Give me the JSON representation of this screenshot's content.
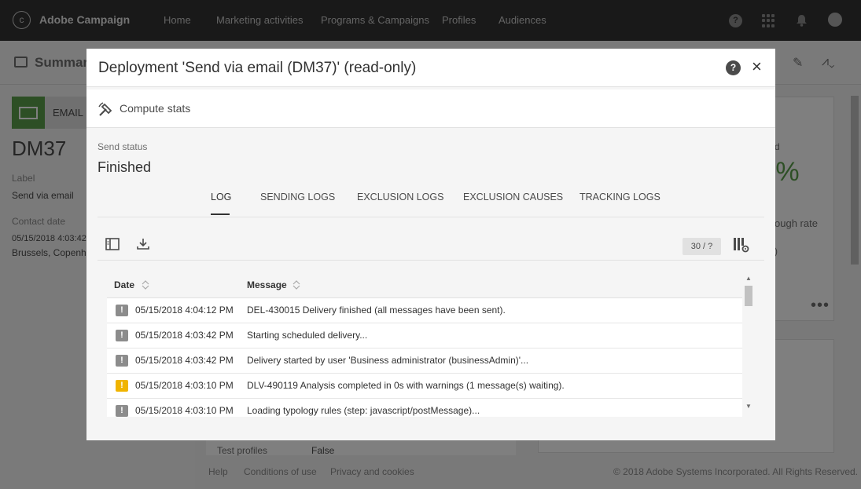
{
  "topbar": {
    "brand": "Adobe Campaign",
    "nav": [
      "Home",
      "Marketing activities",
      "Programs & Campaigns",
      "Profiles",
      "Audiences"
    ],
    "help_glyph": "?"
  },
  "background": {
    "summary_title": "Summary",
    "email_label": "EMAIL",
    "dm_title": "DM37",
    "label_caption": "Label",
    "label_value": "Send via email",
    "contact_caption": "Contact date",
    "contact_value": "05/15/2018 4:03:42",
    "contact_place": "Brussels, Copenha",
    "right_caption": "d",
    "right_pct": ")%",
    "right_rate": "ough rate",
    "right_small": ")",
    "mid_label": "Test profiles",
    "mid_value": "False",
    "footer_links": [
      "Help",
      "Conditions of use",
      "Privacy and cookies"
    ],
    "copyright": "© 2018 Adobe Systems Incorporated. All Rights Reserved."
  },
  "modal": {
    "title": "Deployment 'Send via email (DM37)' (read-only)",
    "help_glyph": "?",
    "close_glyph": "×",
    "compute_label": "Compute stats",
    "send_status_label": "Send status",
    "send_status_value": "Finished",
    "tabs": [
      "LOG",
      "SENDING LOGS",
      "EXCLUSION LOGS",
      "EXCLUSION CAUSES",
      "TRACKING LOGS"
    ],
    "counter": "30 / ?",
    "columns": [
      "Date",
      "Message"
    ],
    "rows": [
      {
        "date": "05/15/2018 4:04:12 PM",
        "message": "DEL-430015 Delivery finished (all messages have been sent).",
        "level": "info"
      },
      {
        "date": "05/15/2018 4:03:42 PM",
        "message": "Starting scheduled delivery...",
        "level": "info"
      },
      {
        "date": "05/15/2018 4:03:42 PM",
        "message": "Delivery started by user 'Business administrator (businessAdmin)'...",
        "level": "info"
      },
      {
        "date": "05/15/2018 4:03:10 PM",
        "message": "DLV-490119 Analysis completed in 0s with warnings (1 message(s) waiting).",
        "level": "warning"
      },
      {
        "date": "05/15/2018 4:03:10 PM",
        "message": "Loading typology rules (step: javascript/postMessage)...",
        "level": "info"
      }
    ],
    "icon_glyph": "!"
  },
  "colors": {
    "info_icon": "#8c8c8c",
    "warning_icon": "#f0b400",
    "accent_green": "#5a9f4b"
  }
}
